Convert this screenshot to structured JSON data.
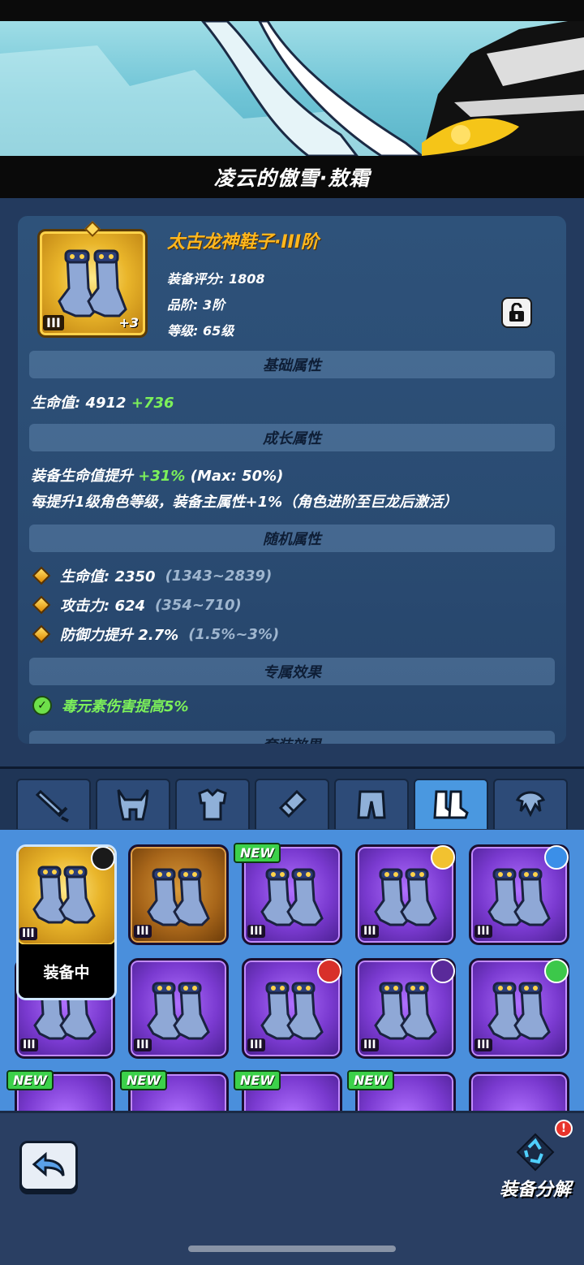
{
  "header": {
    "title": "凌云的傲雪·敖霜"
  },
  "item": {
    "name": "太古龙神鞋子·III阶",
    "tier_badge": "III",
    "enhance": "+3",
    "score": "装备评分: 1808",
    "grade": "品阶: 3阶",
    "level": "等级: 65级"
  },
  "sections": {
    "basic": "基础属性",
    "growth": "成长属性",
    "random": "随机属性",
    "exclusive": "专属效果",
    "set": "套装效果"
  },
  "basic_attrs": {
    "label": "生命值:",
    "value": "4912",
    "bonus": "+736"
  },
  "growth_attrs": {
    "line1_label": "装备生命值提升",
    "line1_bonus": "+31%",
    "line1_max": "(Max: 50%)",
    "line2": "每提升1级角色等级，装备主属性+1%（角色进阶至巨龙后激活）"
  },
  "random_attrs": [
    {
      "text": "生命值: 2350",
      "range": "(1343~2839)"
    },
    {
      "text": "攻击力: 624",
      "range": "(354~710)"
    },
    {
      "text": "防御力提升 2.7%",
      "range": "(1.5%~3%)"
    }
  ],
  "exclusive_effect": "毒元素伤害提高5%",
  "tabs": [
    "sword-icon",
    "helmet-icon",
    "armor-icon",
    "bracer-icon",
    "pants-icon",
    "boots-icon",
    "accessory-icon"
  ],
  "inventory": {
    "equipped_label": "装备中",
    "new_label": "NEW",
    "tier": "III"
  },
  "bottom": {
    "decompose_label": "装备分解",
    "alert": "!"
  },
  "colors": {
    "accent_gold": "#ffb71e",
    "green": "#7cf05a",
    "purple": "#7a3ad0",
    "tab_active": "#4a98e0"
  }
}
